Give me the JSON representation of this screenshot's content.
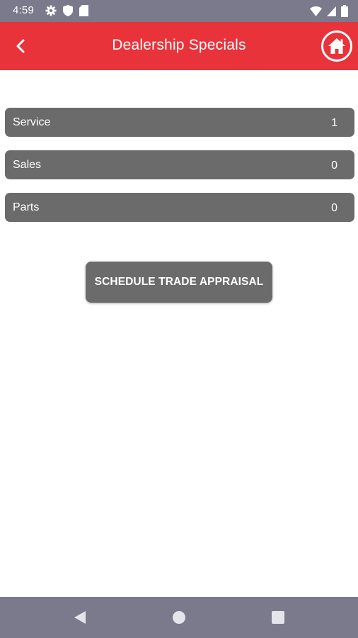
{
  "status_bar": {
    "time": "4:59",
    "left_icons": [
      "settings-icon",
      "shield-icon",
      "sim-card-icon"
    ],
    "right_icons": [
      "wifi-icon",
      "signal-icon",
      "battery-icon"
    ]
  },
  "app_bar": {
    "title": "Dealership Specials",
    "back_icon": "chevron-left-icon",
    "home_icon": "home-icon"
  },
  "categories": [
    {
      "label": "Service",
      "count": "1"
    },
    {
      "label": "Sales",
      "count": "0"
    },
    {
      "label": "Parts",
      "count": "0"
    }
  ],
  "actions": {
    "schedule_appraisal_label": "SCHEDULE TRADE APPRAISAL"
  },
  "nav_bar": {
    "icons": [
      "nav-back-icon",
      "nav-home-icon",
      "nav-recents-icon"
    ]
  },
  "colors": {
    "app_bar": "#e8333b",
    "system_bars": "#7a7a8c",
    "row_background": "#6b6b6b"
  }
}
